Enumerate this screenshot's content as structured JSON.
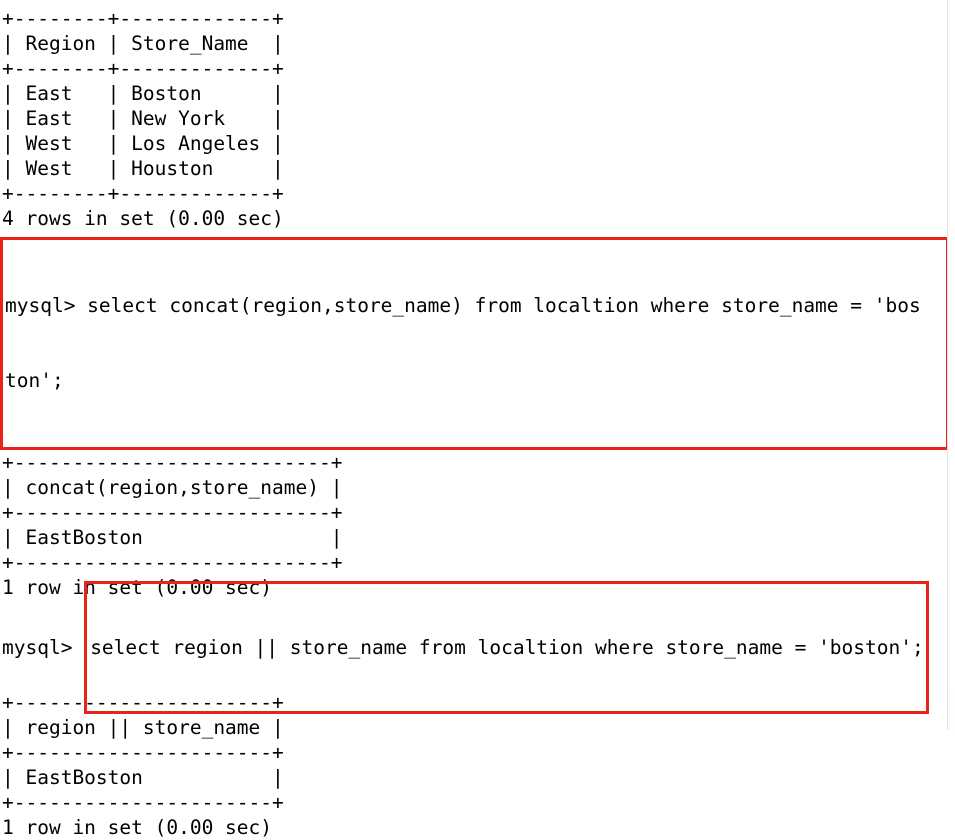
{
  "terminal": {
    "app": "mysql-client-console",
    "prompt": "mysql> ",
    "accent_red": "#e8231a",
    "text_color": "#000000",
    "background": "#ffffff"
  },
  "blocks": {
    "result_one": {
      "name": "locations-result-table",
      "border_top": "+--------+-------------+",
      "header_row": "| Region | Store_Name  |",
      "border_mid": "+--------+-------------+",
      "rows": [
        "| East   | Boston      |",
        "| East   | New York    |",
        "| West   | Los Angeles |",
        "| West   | Houston     |"
      ],
      "border_bottom": "+--------+-------------+",
      "status": "4 rows in set (0.00 sec)"
    },
    "query_one": {
      "name": "concat-query",
      "line_1": "mysql> select concat(region,store_name) from localtion where store_name = 'bos",
      "line_2": "ton';",
      "full_text": "mysql> select concat(region,store_name) from localtion where store_name = 'boston';",
      "highlighted": true
    },
    "result_two": {
      "name": "concat-result-table",
      "border_top": "+---------------------------+",
      "header_row": "| concat(region,store_name) |",
      "border_mid": "+---------------------------+",
      "rows": [
        "| EastBoston                |"
      ],
      "border_bottom": "+---------------------------+",
      "status": "1 row in set (0.00 sec)"
    },
    "query_two": {
      "name": "pipe-concat-query",
      "prompt": "mysql> ",
      "statement": "select region || store_name from localtion where store_name = 'boston';",
      "highlighted": true
    },
    "result_three": {
      "name": "pipe-concat-result-table",
      "border_top": "+----------------------+",
      "header_row": "| region || store_name |",
      "border_mid": "+----------------------+",
      "rows": [
        "| EastBoston           |"
      ],
      "border_bottom": "+----------------------+",
      "status": "1 row in set (0.00 sec)"
    }
  }
}
